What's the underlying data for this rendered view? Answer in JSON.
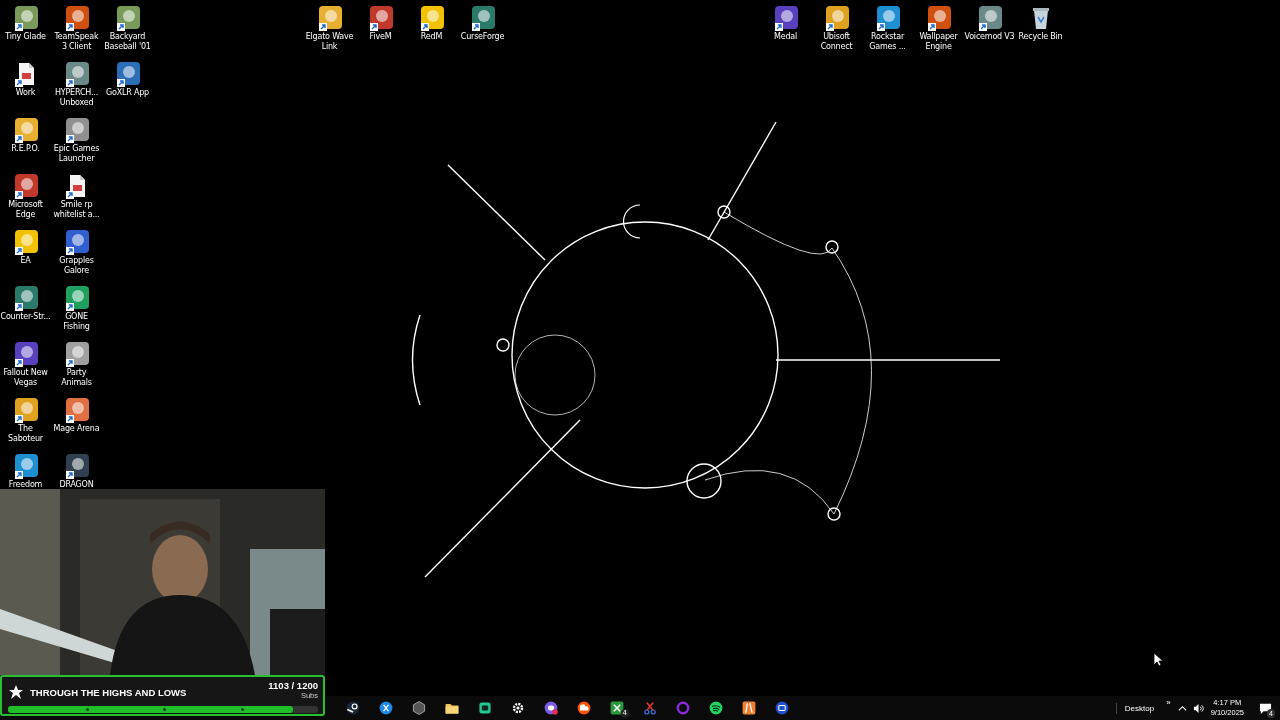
{
  "desktop": {
    "left_columns": [
      [
        {
          "label": "Tiny Glade",
          "kind": "app"
        },
        {
          "label": "Work",
          "kind": "file"
        },
        {
          "label": "R.E.P.O.",
          "kind": "app"
        },
        {
          "label": "Microsoft Edge",
          "kind": "app"
        },
        {
          "label": "EA",
          "kind": "app"
        },
        {
          "label": "Counter-Str...",
          "kind": "app"
        },
        {
          "label": "Fallout New Vegas",
          "kind": "app"
        },
        {
          "label": "The Saboteur",
          "kind": "app"
        },
        {
          "label": "Freedom",
          "kind": "app"
        }
      ],
      [
        {
          "label": "TeamSpeak 3 Client",
          "kind": "app"
        },
        {
          "label": "HYPERCH... Unboxed",
          "kind": "app"
        },
        {
          "label": "Epic Games Launcher",
          "kind": "app"
        },
        {
          "label": "Smile rp whitelist a...",
          "kind": "file"
        },
        {
          "label": "Grapples Galore",
          "kind": "app"
        },
        {
          "label": "GONE Fishing",
          "kind": "app"
        },
        {
          "label": "Party Animals",
          "kind": "app"
        },
        {
          "label": "Mage Arena",
          "kind": "app"
        },
        {
          "label": "DRAGON",
          "kind": "app"
        }
      ],
      [
        {
          "label": "Backyard Baseball '01",
          "kind": "app"
        },
        {
          "label": "GoXLR App",
          "kind": "app"
        }
      ]
    ],
    "top_middle": [
      {
        "label": "Elgato Wave Link",
        "kind": "app"
      },
      {
        "label": "FiveM",
        "kind": "app"
      },
      {
        "label": "RedM",
        "kind": "app"
      },
      {
        "label": "CurseForge",
        "kind": "app"
      }
    ],
    "top_right": [
      {
        "label": "Medal",
        "kind": "app"
      },
      {
        "label": "Ubisoft Connect",
        "kind": "app"
      },
      {
        "label": "Rockstar Games ...",
        "kind": "app"
      },
      {
        "label": "Wallpaper Engine",
        "kind": "app"
      },
      {
        "label": "Voicemod V3",
        "kind": "app"
      },
      {
        "label": "Recycle Bin",
        "kind": "bin"
      }
    ]
  },
  "sub_goal": {
    "title": "THROUGH THE HIGHS AND LOWS",
    "count": "1103 / 1200",
    "unit": "Subs",
    "level": 0.92
  },
  "taskbar": {
    "apps": [
      {
        "kind": "steam"
      },
      {
        "kind": "blue"
      },
      {
        "kind": "hexagon"
      },
      {
        "kind": "folder"
      },
      {
        "kind": "greenbox"
      },
      {
        "kind": "gear"
      },
      {
        "kind": "discord"
      },
      {
        "kind": "orange"
      },
      {
        "kind": "xbox",
        "badge": "4"
      },
      {
        "kind": "scissors"
      },
      {
        "kind": "ring"
      },
      {
        "kind": "spotify"
      },
      {
        "kind": "fivem"
      },
      {
        "kind": "wallpaper"
      }
    ],
    "toolbar_label": "Desktop",
    "toolbar_more": "»",
    "time": "4:17 PM",
    "date": "9/10/2025",
    "notification_count": "4"
  }
}
